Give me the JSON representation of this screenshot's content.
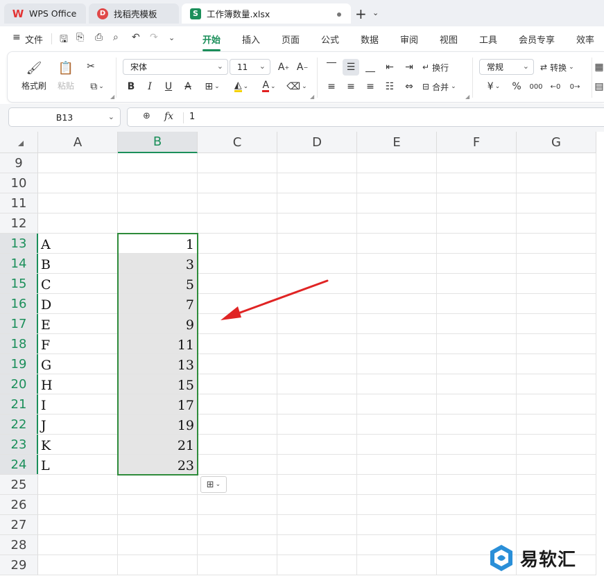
{
  "colors": {
    "accent": "#1b8f5a",
    "selection_border": "#2e8b3a",
    "arrow": "#e02424",
    "font_color_bar": "#e02020",
    "fill_color_bar": "#f3d000"
  },
  "tabs": [
    {
      "label": "WPS Office",
      "icon": "wps-logo-icon"
    },
    {
      "label": "找稻壳模板",
      "icon": "docer-icon"
    },
    {
      "label": "工作簿数量.xlsx",
      "icon": "spreadsheet-s-icon",
      "active": true
    }
  ],
  "menu": {
    "file_label": "文件",
    "items": [
      "开始",
      "插入",
      "页面",
      "公式",
      "数据",
      "审阅",
      "视图",
      "工具",
      "会员专享",
      "效率"
    ],
    "active_index": 0
  },
  "ribbon": {
    "format_painter": "格式刷",
    "paste": "粘贴",
    "font_name": "宋体",
    "font_size": "11",
    "wrap_text": "换行",
    "merge": "合并",
    "number_format": "常规",
    "convert": "转换",
    "currency_symbol": "¥",
    "percent_symbol": "%"
  },
  "formula_bar": {
    "name_box": "B13",
    "fx_label": "fx",
    "value": "1"
  },
  "sheet": {
    "columns": [
      "A",
      "B",
      "C",
      "D",
      "E",
      "F",
      "G"
    ],
    "selected_column": "B",
    "rows": [
      {
        "n": "9",
        "a": "",
        "b": ""
      },
      {
        "n": "10",
        "a": "",
        "b": ""
      },
      {
        "n": "11",
        "a": "",
        "b": ""
      },
      {
        "n": "12",
        "a": "",
        "b": ""
      },
      {
        "n": "13",
        "a": "A",
        "b": "1"
      },
      {
        "n": "14",
        "a": "B",
        "b": "3"
      },
      {
        "n": "15",
        "a": "C",
        "b": "5"
      },
      {
        "n": "16",
        "a": "D",
        "b": "7"
      },
      {
        "n": "17",
        "a": "E",
        "b": "9"
      },
      {
        "n": "18",
        "a": "F",
        "b": "11"
      },
      {
        "n": "19",
        "a": "G",
        "b": "13"
      },
      {
        "n": "20",
        "a": "H",
        "b": "15"
      },
      {
        "n": "21",
        "a": "I",
        "b": "17"
      },
      {
        "n": "22",
        "a": "J",
        "b": "19"
      },
      {
        "n": "23",
        "a": "K",
        "b": "21"
      },
      {
        "n": "24",
        "a": "L",
        "b": "23"
      },
      {
        "n": "25",
        "a": "",
        "b": ""
      },
      {
        "n": "26",
        "a": "",
        "b": ""
      },
      {
        "n": "27",
        "a": "",
        "b": ""
      },
      {
        "n": "28",
        "a": "",
        "b": ""
      },
      {
        "n": "29",
        "a": "",
        "b": ""
      }
    ],
    "selected_rows": [
      "13",
      "14",
      "15",
      "16",
      "17",
      "18",
      "19",
      "20",
      "21",
      "22",
      "23",
      "24"
    ]
  },
  "watermark": {
    "text": "易软汇"
  }
}
